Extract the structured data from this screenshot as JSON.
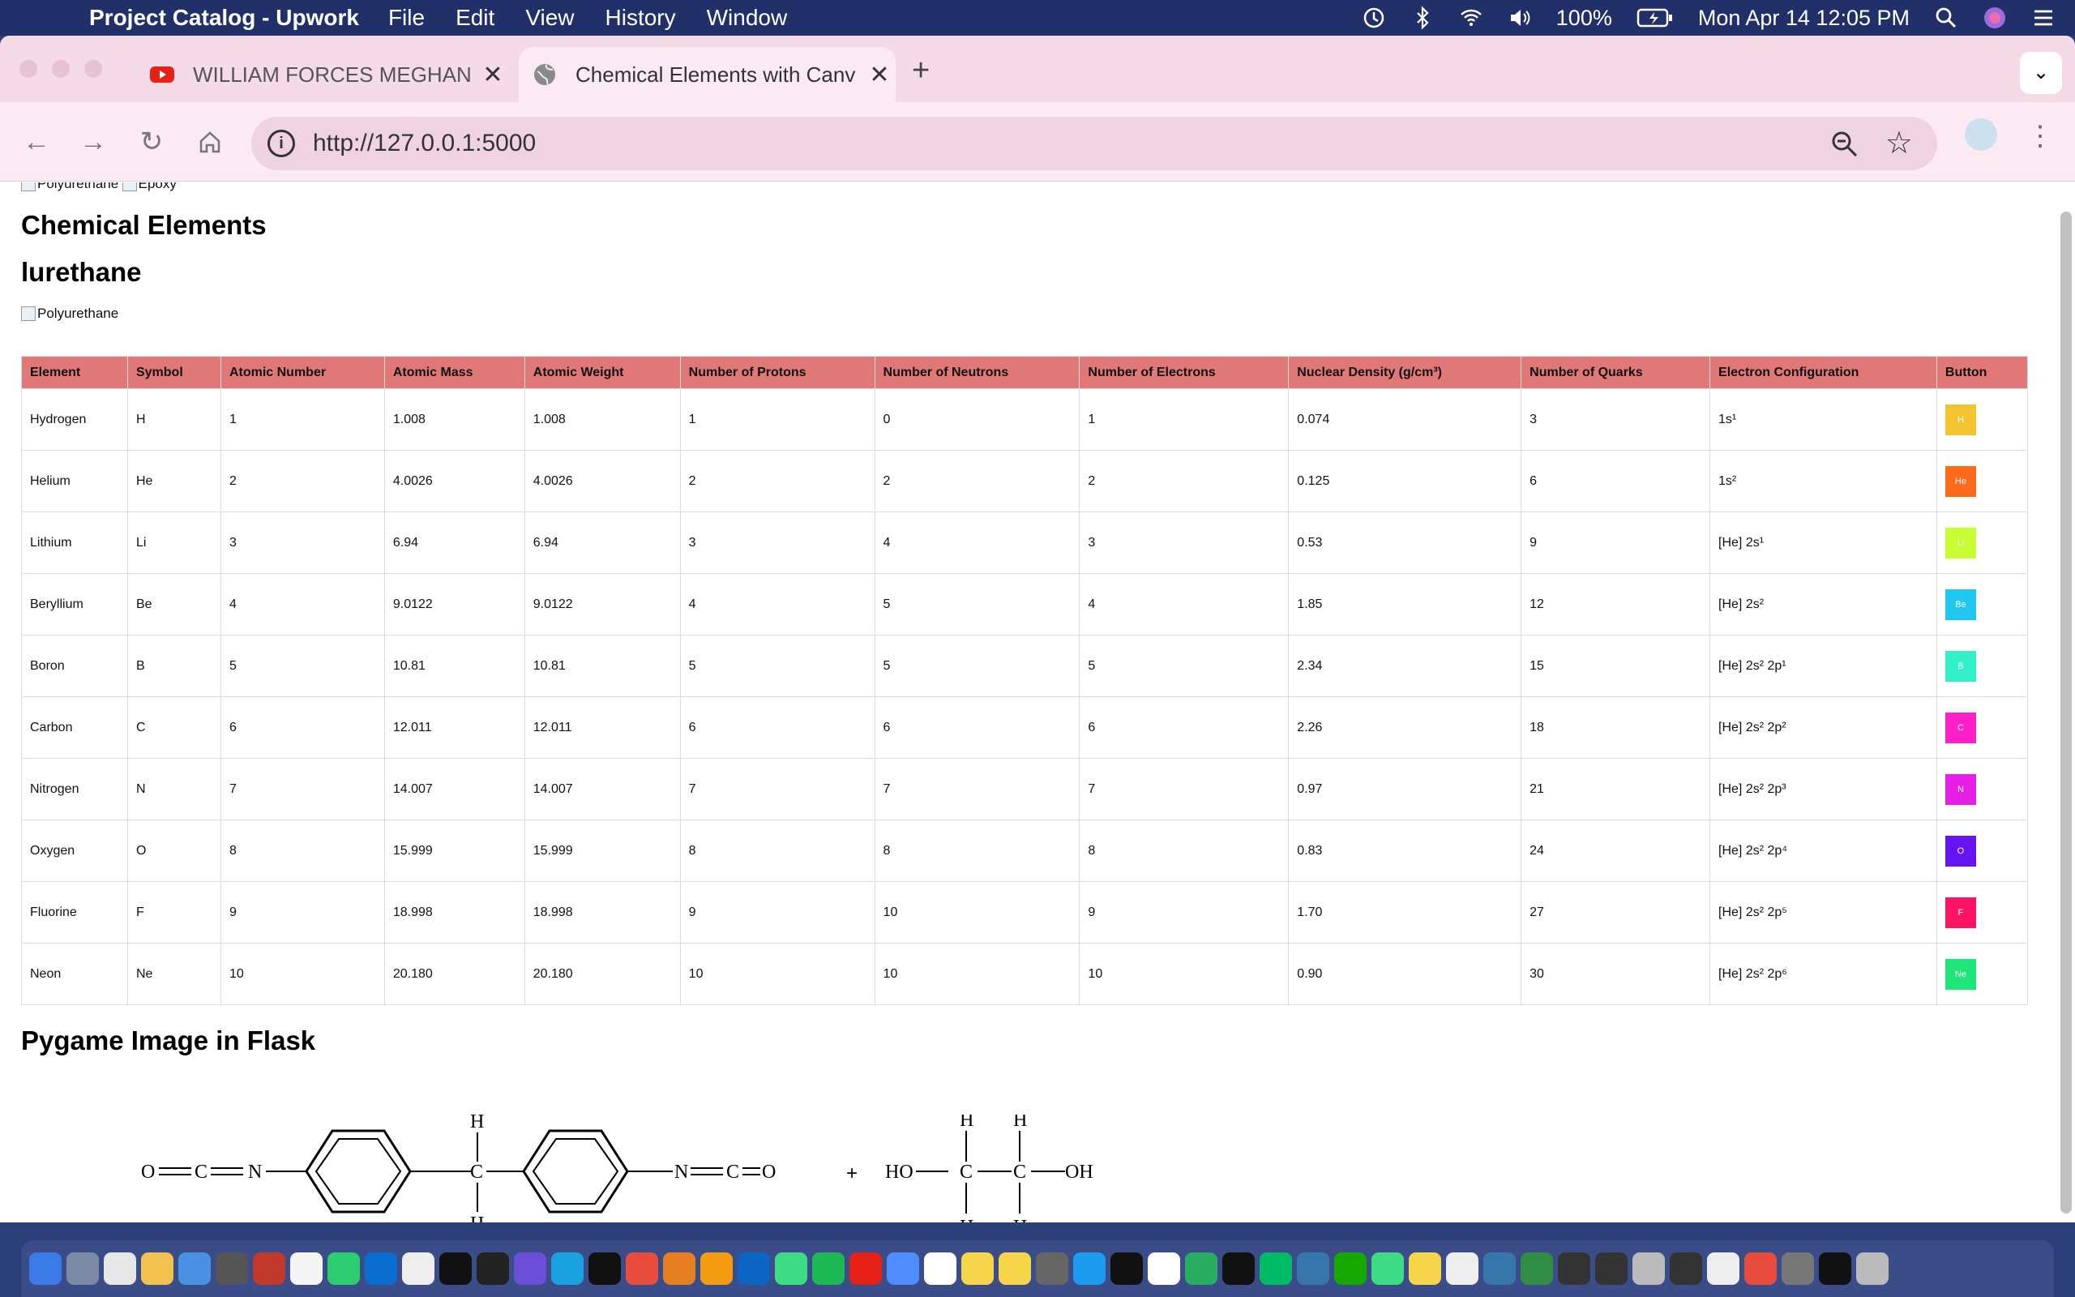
{
  "menubar": {
    "app_name": "Project Catalog - Upwork",
    "menus": [
      "File",
      "Edit",
      "View",
      "History",
      "Window"
    ],
    "battery": "100%",
    "datetime": "Mon Apr 14  12:05 PM"
  },
  "browser": {
    "tabs": [
      {
        "title": "WILLIAM FORCES MEGHAN &",
        "active": false
      },
      {
        "title": "Chemical Elements with Canv",
        "active": true
      }
    ],
    "url": "http://127.0.0.1:5000"
  },
  "page": {
    "top_images": [
      "Polyurethane",
      "Epoxy"
    ],
    "heading1": "Chemical Elements",
    "heading2": "lurethane",
    "poly_image_alt": "Polyurethane",
    "table": {
      "headers": [
        "Element",
        "Symbol",
        "Atomic Number",
        "Atomic Mass",
        "Atomic Weight",
        "Number of Protons",
        "Number of Neutrons",
        "Number of Electrons",
        "Nuclear Density (g/cm³)",
        "Number of Quarks",
        "Electron Configuration",
        "Button"
      ],
      "rows": [
        {
          "element": "Hydrogen",
          "symbol": "H",
          "atomic_number": "1",
          "atomic_mass": "1.008",
          "atomic_weight": "1.008",
          "protons": "1",
          "neutrons": "0",
          "electrons": "1",
          "density": "0.074",
          "quarks": "3",
          "config": "1s¹",
          "button": "H",
          "color": "#f4c430"
        },
        {
          "element": "Helium",
          "symbol": "He",
          "atomic_number": "2",
          "atomic_mass": "4.0026",
          "atomic_weight": "4.0026",
          "protons": "2",
          "neutrons": "2",
          "electrons": "2",
          "density": "0.125",
          "quarks": "6",
          "config": "1s²",
          "button": "He",
          "color": "#ff6a1a"
        },
        {
          "element": "Lithium",
          "symbol": "Li",
          "atomic_number": "3",
          "atomic_mass": "6.94",
          "atomic_weight": "6.94",
          "protons": "3",
          "neutrons": "4",
          "electrons": "3",
          "density": "0.53",
          "quarks": "9",
          "config": "[He] 2s¹",
          "button": "Li",
          "color": "#c8ff32"
        },
        {
          "element": "Beryllium",
          "symbol": "Be",
          "atomic_number": "4",
          "atomic_mass": "9.0122",
          "atomic_weight": "9.0122",
          "protons": "4",
          "neutrons": "5",
          "electrons": "4",
          "density": "1.85",
          "quarks": "12",
          "config": "[He] 2s²",
          "button": "Be",
          "color": "#1ec8f0"
        },
        {
          "element": "Boron",
          "symbol": "B",
          "atomic_number": "5",
          "atomic_mass": "10.81",
          "atomic_weight": "10.81",
          "protons": "5",
          "neutrons": "5",
          "electrons": "5",
          "density": "2.34",
          "quarks": "15",
          "config": "[He] 2s² 2p¹",
          "button": "B",
          "color": "#32f0c8"
        },
        {
          "element": "Carbon",
          "symbol": "C",
          "atomic_number": "6",
          "atomic_mass": "12.011",
          "atomic_weight": "12.011",
          "protons": "6",
          "neutrons": "6",
          "electrons": "6",
          "density": "2.26",
          "quarks": "18",
          "config": "[He] 2s² 2p²",
          "button": "C",
          "color": "#ff1ec8"
        },
        {
          "element": "Nitrogen",
          "symbol": "N",
          "atomic_number": "7",
          "atomic_mass": "14.007",
          "atomic_weight": "14.007",
          "protons": "7",
          "neutrons": "7",
          "electrons": "7",
          "density": "0.97",
          "quarks": "21",
          "config": "[He] 2s² 2p³",
          "button": "N",
          "color": "#e61ee6"
        },
        {
          "element": "Oxygen",
          "symbol": "O",
          "atomic_number": "8",
          "atomic_mass": "15.999",
          "atomic_weight": "15.999",
          "protons": "8",
          "neutrons": "8",
          "electrons": "8",
          "density": "0.83",
          "quarks": "24",
          "config": "[He] 2s² 2p⁴",
          "button": "O",
          "color": "#6414f0"
        },
        {
          "element": "Fluorine",
          "symbol": "F",
          "atomic_number": "9",
          "atomic_mass": "18.998",
          "atomic_weight": "18.998",
          "protons": "9",
          "neutrons": "10",
          "electrons": "9",
          "density": "1.70",
          "quarks": "27",
          "config": "[He] 2s² 2p⁵",
          "button": "F",
          "color": "#ff1464"
        },
        {
          "element": "Neon",
          "symbol": "Ne",
          "atomic_number": "10",
          "atomic_mass": "20.180",
          "atomic_weight": "20.180",
          "protons": "10",
          "neutrons": "10",
          "electrons": "10",
          "density": "0.90",
          "quarks": "30",
          "config": "[He] 2s² 2p⁶",
          "button": "Ne",
          "color": "#1ee678"
        }
      ]
    },
    "heading3": "Pygame Image in Flask",
    "diagram_labels": {
      "isocyanate_left": "O",
      "c": "C",
      "n": "N",
      "h": "H",
      "plus": "+",
      "ho": "HO",
      "oh": "OH"
    }
  },
  "colors": {
    "table_header": "#e07878",
    "tabstrip": "#f4dbe6",
    "toolbar": "#fbeaf1",
    "menubar": "#22306a"
  }
}
